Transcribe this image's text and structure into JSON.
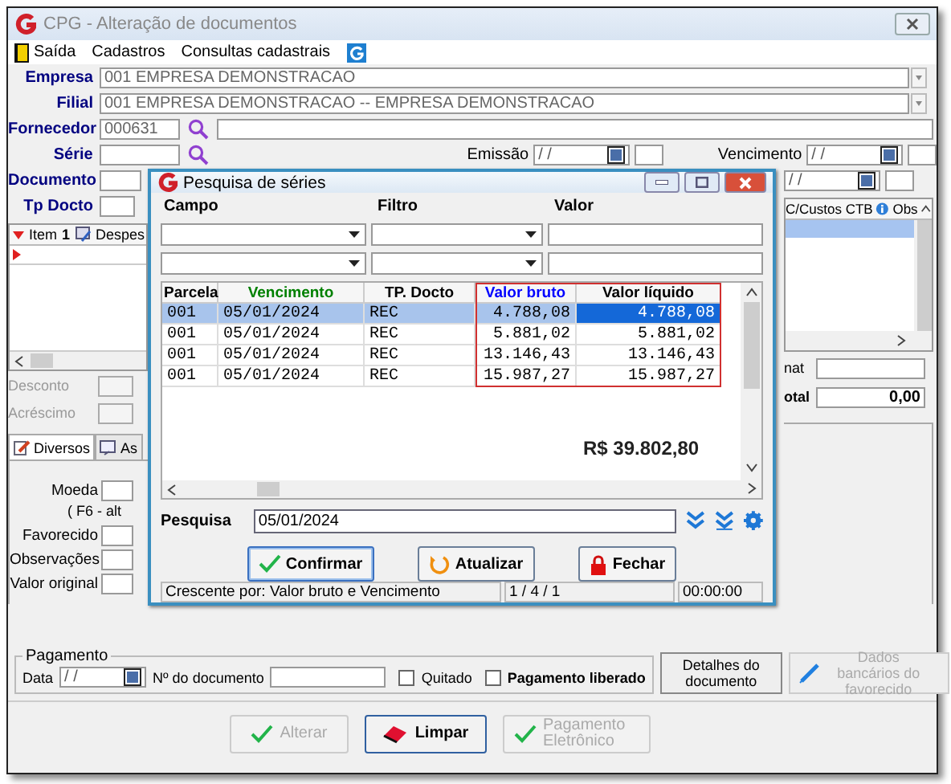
{
  "window": {
    "title": "CPG - Alteração de documentos"
  },
  "menu": [
    {
      "label": "Saída",
      "kind": "exit"
    },
    {
      "label": "Cadastros",
      "kind": "plain"
    },
    {
      "label": "Consultas cadastrais",
      "kind": "plain"
    }
  ],
  "form": {
    "empresa": {
      "label": "Empresa",
      "value": "001 EMPRESA DEMONSTRACAO"
    },
    "filial": {
      "label": "Filial",
      "value": "001 EMPRESA DEMONSTRACAO -- EMPRESA DEMONSTRACAO"
    },
    "fornecedor": {
      "label": "Fornecedor",
      "value": "000631"
    },
    "serie": {
      "label": "Série"
    },
    "emissao": {
      "label": "Emissão",
      "value": "/ /"
    },
    "vencimento": {
      "label": "Vencimento",
      "value": "/ /"
    },
    "documento": {
      "label": "Documento"
    },
    "date_2": {
      "value": "/ /"
    },
    "tp_docto": {
      "label": "Tp Docto"
    }
  },
  "items_grid": {
    "columns": [
      "Item",
      "1",
      "Despes"
    ],
    "right_columns": [
      "C/Custos CTB",
      "Obs"
    ]
  },
  "totals": {
    "desconto": "Desconto",
    "acrescimo": "Acréscimo",
    "label_3": "nat",
    "label_4": "otal",
    "value_4": "0,00"
  },
  "tabs": [
    {
      "label": "Diversos",
      "selected": true
    },
    {
      "label": "As",
      "selected": false
    }
  ],
  "diversos": {
    "moeda": "Moeda",
    "hint": "( F6 - alt",
    "favorecido": "Favorecido",
    "observacoes": "Observações",
    "valor_original": "Valor original"
  },
  "pagamento": {
    "title": "Pagamento",
    "data_label": "Data",
    "data_value": "/ /",
    "doc_label": "Nº do documento",
    "quitado": {
      "label": "Quitado",
      "checked": false
    },
    "liberado": {
      "label": "Pagamento liberado",
      "checked": false
    }
  },
  "side_buttons": [
    {
      "label": "Detalhes do documento",
      "disabled": false,
      "kind": "plain"
    },
    {
      "label": "Dados bancários do favorecido",
      "disabled": true,
      "kind": "pencil"
    }
  ],
  "buttons": [
    {
      "label": "Alterar",
      "disabled": true,
      "kind": "check"
    },
    {
      "label": "Limpar",
      "disabled": false,
      "kind": "eraser"
    },
    {
      "label": "Pagamento Eletrônico",
      "disabled": true,
      "kind": "check"
    }
  ],
  "dialog": {
    "title": "Pesquisa de séries",
    "filter_labels": [
      "Campo",
      "Filtro",
      "Valor"
    ],
    "columns": [
      {
        "label": "Parcela",
        "color": "#000000"
      },
      {
        "label": "Vencimento",
        "color": "#008000"
      },
      {
        "label": "TP. Docto",
        "color": "#000000"
      },
      {
        "label": "Valor bruto",
        "color": "#0000ff"
      },
      {
        "label": "Valor líquido",
        "color": "#000000"
      }
    ],
    "rows": [
      {
        "cells": [
          "001",
          "05/01/2024",
          "REC",
          "4.788,08",
          "4.788,08"
        ],
        "selected": true
      },
      {
        "cells": [
          "001",
          "05/01/2024",
          "REC",
          "5.881,02",
          "5.881,02"
        ],
        "selected": false
      },
      {
        "cells": [
          "001",
          "05/01/2024",
          "REC",
          "13.146,43",
          "13.146,43"
        ],
        "selected": false
      },
      {
        "cells": [
          "001",
          "05/01/2024",
          "REC",
          "15.987,27",
          "15.987,27"
        ],
        "selected": false
      }
    ],
    "total": "R$ 39.802,80",
    "search": {
      "label": "Pesquisa",
      "value": "05/01/2024"
    },
    "buttons": [
      {
        "label": "Confirmar",
        "kind": "confirm"
      },
      {
        "label": "Atualizar",
        "kind": "refresh"
      },
      {
        "label": "Fechar",
        "kind": "lock"
      }
    ],
    "status": [
      "Crescente por: Valor bruto e Vencimento",
      "1 / 4 / 1",
      "00:00:00"
    ]
  }
}
